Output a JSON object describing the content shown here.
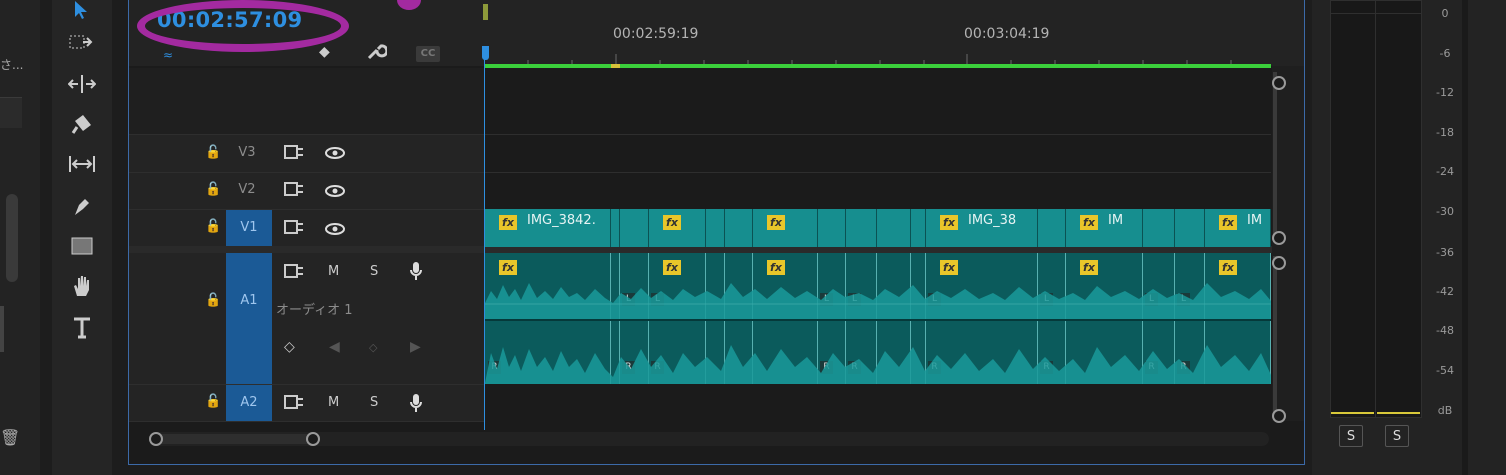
{
  "left_panel": {
    "partial_text": "さ..."
  },
  "timeline": {
    "timecode": "00:02:57:09",
    "ruler_labels": [
      "00:02:59:19",
      "00:03:04:19"
    ],
    "header_icons": [
      "snap-icon",
      "linked-selection-icon",
      "add-marker-icon",
      "wrench-icon",
      "captions-icon"
    ],
    "captions_label": "CC"
  },
  "tracks": {
    "v3": {
      "name": "V3"
    },
    "v2": {
      "name": "V2"
    },
    "v1": {
      "name": "V1"
    },
    "a1": {
      "name": "A1",
      "label": "オーディオ 1",
      "m": "M",
      "s": "S"
    },
    "a2": {
      "name": "A2",
      "m": "M",
      "s": "S"
    }
  },
  "clips": {
    "v1_names": [
      "IMG_3842.",
      "IMG_38",
      "IM",
      "IM"
    ],
    "fx_label": "fx",
    "audio_left": "L",
    "audio_right": "R"
  },
  "meter": {
    "db_scale": [
      "0",
      "-6",
      "-12",
      "-18",
      "-24",
      "-30",
      "-36",
      "-42",
      "-48",
      "-54",
      "dB"
    ],
    "solo_left": "S",
    "solo_right": "S"
  },
  "colors": {
    "accent": "#2e8fe0",
    "clip": "#168e8f",
    "audio_clip": "#0b5b5c",
    "fx": "#e9c62a",
    "annotation": "#a32aa0",
    "in_out_bar": "#3bcf3b"
  }
}
